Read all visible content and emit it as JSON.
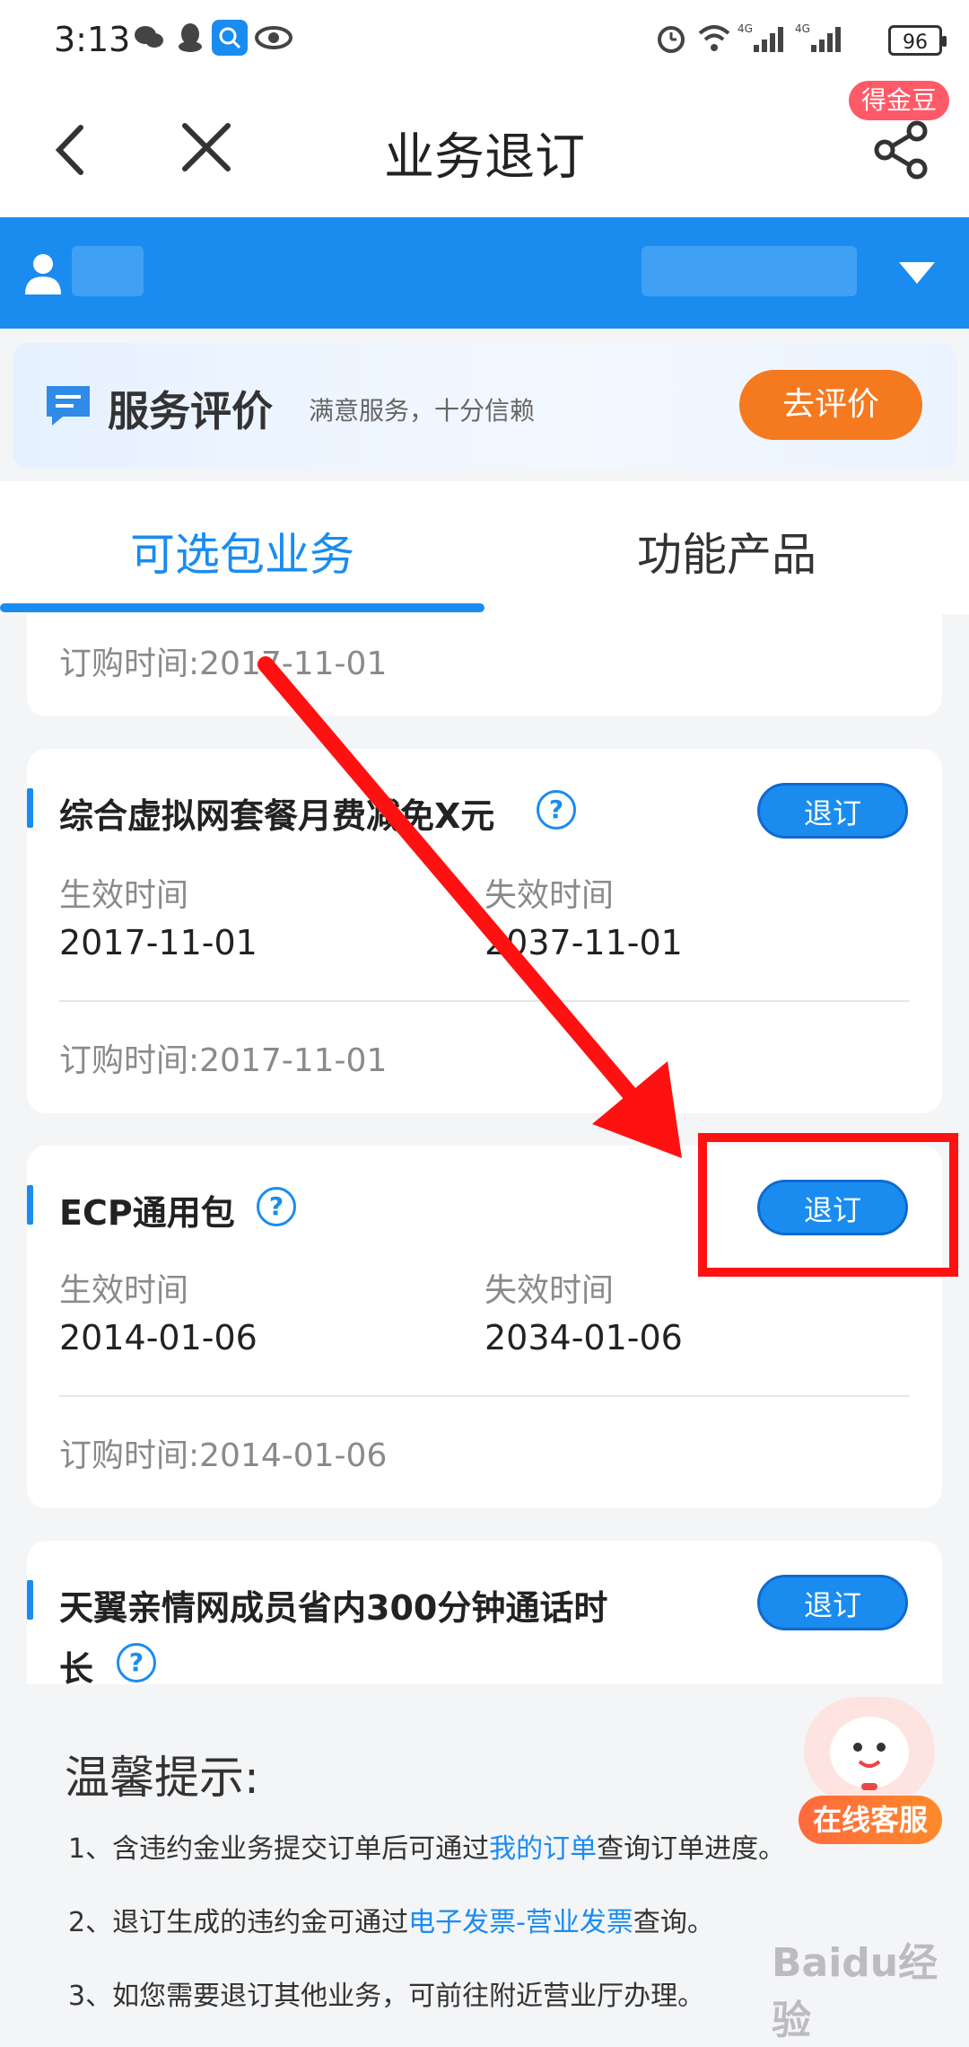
{
  "status_bar": {
    "time": "3:13",
    "battery": "96"
  },
  "nav": {
    "title": "业务退订",
    "badge": "得金豆"
  },
  "banner": {
    "title": "服务评价",
    "subtitle": "满意服务，十分信赖",
    "button": "去评价"
  },
  "tabs": [
    {
      "label": "可选包业务"
    },
    {
      "label": "功能产品"
    }
  ],
  "cards": [
    {
      "order_time": "订购时间:2017-11-01"
    },
    {
      "title": "综合虚拟网套餐月费减免X元",
      "unsubscribe": "退订",
      "start_label": "生效时间",
      "start": "2017-11-01",
      "end_label": "失效时间",
      "end": "2037-11-01",
      "order_time": "订购时间:2017-11-01"
    },
    {
      "title": "ECP通用包",
      "unsubscribe": "退订",
      "start_label": "生效时间",
      "start": "2014-01-06",
      "end_label": "失效时间",
      "end": "2034-01-06",
      "order_time": "订购时间:2014-01-06"
    },
    {
      "title_line1": "天翼亲情网成员省内300分钟通话时",
      "title_line2": "长",
      "unsubscribe": "退订"
    }
  ],
  "tips": {
    "title": "温馨提示:",
    "line1_prefix": "1、含违约金业务提交订单后可通过",
    "line1_link": "我的订单",
    "line1_suffix": "查询订单进度。",
    "line2_prefix": "2、退订生成的违约金可通过",
    "line2_link": "电子发票-营业发票",
    "line2_suffix": "查询。",
    "line3": "3、如您需要退订其他业务，可前往附近营业厅办理。"
  },
  "service": {
    "label": "在线客服"
  },
  "watermark": "Baidu经验",
  "colors": {
    "primary": "#1a8cf0",
    "orange": "#f5791f",
    "annotation": "#ff1111"
  }
}
